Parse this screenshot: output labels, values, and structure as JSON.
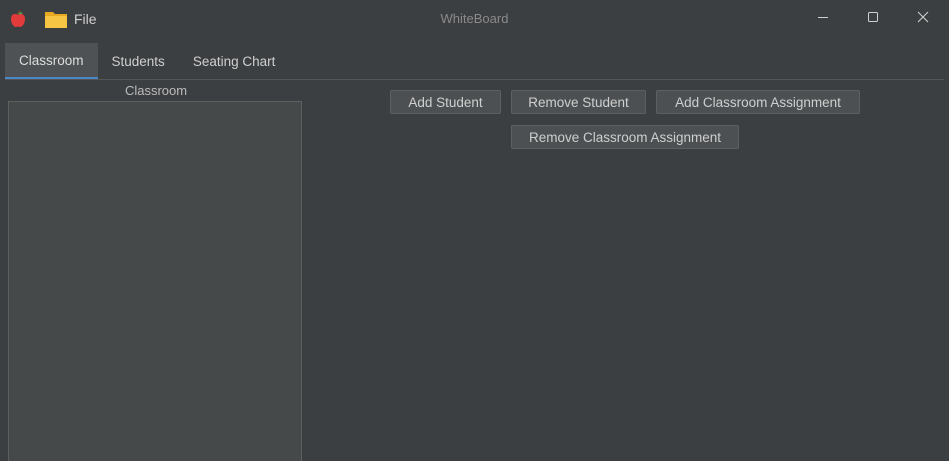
{
  "window": {
    "title": "WhiteBoard",
    "menu_file_label": "File"
  },
  "tabs": [
    {
      "label": "Classroom",
      "active": true
    },
    {
      "label": "Students",
      "active": false
    },
    {
      "label": "Seating Chart",
      "active": false
    }
  ],
  "classroom_panel": {
    "title": "Classroom",
    "items": []
  },
  "buttons": {
    "add_student": "Add Student",
    "remove_student": "Remove Student",
    "add_classroom_assignment": "Add Classroom Assignment",
    "remove_classroom_assignment": "Remove Classroom Assignment"
  },
  "icons": {
    "app": "apple-icon",
    "file": "folder-icon",
    "minimize": "minimize-icon",
    "maximize": "maximize-icon",
    "close": "close-icon"
  },
  "colors": {
    "background": "#3c3f41",
    "tab_active": "#4e5254",
    "tab_indicator": "#4a88c7",
    "list_background": "#45494a",
    "button_background": "#4c5052"
  }
}
